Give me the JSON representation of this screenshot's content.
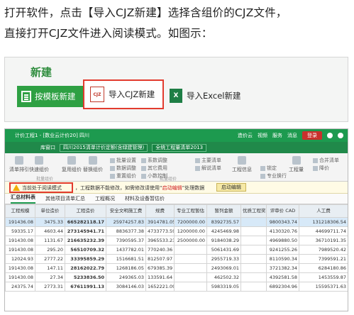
{
  "intro": {
    "line1": "打开软件，点击【导入CJZ新建】选择含组价的CJZ文件，",
    "line2": "直接打开CJZ文件进入阅读模式。如图示："
  },
  "new_panel": {
    "title": "新建",
    "template_button": "按模板新建",
    "cjz_button": "导入CJZ新建",
    "cjz_icon_text": "CJZ",
    "excel_button": "导入Excel新建",
    "excel_icon_text": "X"
  },
  "app": {
    "window_title": "计价工程1 - [数业云计价20] 四川",
    "title_right": [
      "造价云",
      "视频",
      "服务",
      "消息"
    ],
    "login": "登录",
    "project_label": "库窗口",
    "project_select": "四川2015清单计价定额(含绿建管理)",
    "list_select": "全统工程量清单2013",
    "toolbar": [
      "清单排引",
      "快速组价",
      "复用组价",
      "替换组价",
      "系数调整",
      "其它费用",
      "小数控制",
      "主要清单",
      "解说清单",
      "工程信息",
      "锁定",
      "专业换行",
      "工程量",
      "合并清单",
      "降价"
    ],
    "toolbar_small": [
      "批量设置",
      "数据调整",
      "重置组价"
    ],
    "toolbar_group_label": "批量组价",
    "notice_highlight": "当前处于阅读模式",
    "notice_text": "，工程数据不能修改，如需修改请使用“",
    "notice_red": "启动编辑",
    "notice_tail": "”处理数据",
    "edit_button": "启动编辑",
    "tabs": [
      "汇总材料表",
      "其他项目清单汇总",
      "工程概况",
      "材料及设备暂估价"
    ],
    "columns": [
      "工程规模",
      "单位造价",
      "工程造价",
      "安全文明施工费",
      "规费",
      "专业工程暂估",
      "暂列金额",
      "优质工程奖",
      "评审价 CAD",
      "人工费"
    ],
    "rows": [
      [
        "191436.08",
        "3475.33",
        "665282118.17",
        "25974257.83",
        "3914781.05",
        "7200000.00",
        "8392735.57",
        "",
        "9800343.74",
        "131218306.54"
      ],
      [
        "59335.17",
        "4603.44",
        "273145941.71",
        "8836377.38",
        "4733773.59",
        "1200000.00",
        "4245469.98",
        "",
        "4130320.76",
        "44699711.74"
      ],
      [
        "191430.08",
        "1131.67",
        "216635232.39",
        "7390595.37",
        "3965533.23",
        "2500000.00",
        "9184038.29",
        "",
        "4969880.50",
        "36710191.35"
      ],
      [
        "191430.08",
        "295.20",
        "56510709.32",
        "1437782.01",
        "770240.36",
        "",
        "5061431.69",
        "",
        "9241255.26",
        "7989520.42"
      ],
      [
        "12024.93",
        "2777.22",
        "33395859.29",
        "1516681.51",
        "812507.97",
        "",
        "2955719.33",
        "",
        "8110590.34",
        "7399591.21"
      ],
      [
        "191430.08",
        "147.11",
        "28162022.79",
        "1268186.05",
        "679385.39",
        "",
        "2493069.01",
        "",
        "3721382.34",
        "6284180.86"
      ],
      [
        "191430.08",
        "27.34",
        "5233836.50",
        "249365.03",
        "133591.64",
        "",
        "462502.32",
        "",
        "4392581.58",
        "1453559.87"
      ],
      [
        "24375.74",
        "2773.31",
        "67611991.13",
        "3084146.03",
        "1652221.09",
        "",
        "5983319.05",
        "",
        "6892304.96",
        "15595371.63"
      ]
    ]
  }
}
